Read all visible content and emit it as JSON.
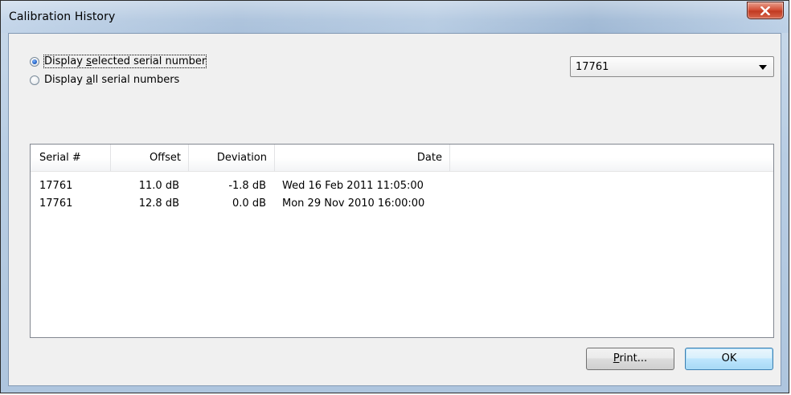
{
  "window": {
    "title": "Calibration History",
    "close_icon": "close-icon"
  },
  "options": {
    "selected_label_pre": "Display ",
    "selected_label_u": "s",
    "selected_label_post": "elected serial number",
    "all_label_pre": "Display ",
    "all_label_u": "a",
    "all_label_post": "ll serial numbers",
    "selected_option": "selected"
  },
  "serial_select": {
    "value": "17761",
    "arrow_icon": "chevron-down-icon"
  },
  "table": {
    "columns": [
      "Serial #",
      "Offset",
      "Deviation",
      "Date"
    ],
    "rows": [
      {
        "serial": "17761",
        "offset": "11.0 dB",
        "deviation": "-1.8 dB",
        "date": "Wed 16 Feb 2011 11:05:00"
      },
      {
        "serial": "17761",
        "offset": "12.8 dB",
        "deviation": "0.0 dB",
        "date": "Mon 29 Nov 2010 16:00:00"
      }
    ]
  },
  "buttons": {
    "print_u": "P",
    "print_rest": "rint...",
    "ok": "OK"
  }
}
